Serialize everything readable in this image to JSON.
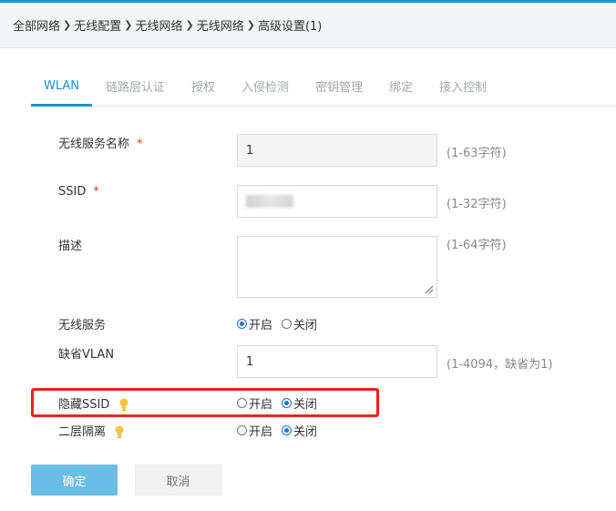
{
  "breadcrumb": {
    "items": [
      "全部网络",
      "无线配置",
      "无线网络",
      "无线网络",
      "高级设置(1)"
    ],
    "separator": "❯"
  },
  "tabs": [
    "WLAN",
    "链路层认证",
    "授权",
    "入侵检测",
    "密钥管理",
    "绑定",
    "接入控制"
  ],
  "form": {
    "service_name": {
      "label": "无线服务名称",
      "required_mark": "*",
      "value": "1",
      "hint": "(1-63字符)"
    },
    "ssid": {
      "label": "SSID",
      "required_mark": "*",
      "hint": "(1-32字符)"
    },
    "description": {
      "label": "描述",
      "value": "",
      "hint": "(1-64字符)"
    },
    "wireless_service": {
      "label": "无线服务",
      "on_label": "开启",
      "off_label": "关闭",
      "selected": "开启"
    },
    "default_vlan": {
      "label": "缺省VLAN",
      "value": "1",
      "hint": "(1-4094，缺省为1)"
    },
    "hide_ssid": {
      "label": "隐藏SSID",
      "on_label": "开启",
      "off_label": "关闭",
      "selected": "关闭"
    },
    "layer2_isolation": {
      "label": "二层隔离",
      "on_label": "开启",
      "off_label": "关闭",
      "selected": "关闭"
    }
  },
  "buttons": {
    "ok": "确定",
    "cancel": "取消"
  },
  "colors": {
    "accent": "#1e90d6",
    "highlight": "#e8231b",
    "bulb": "#f5c242"
  }
}
